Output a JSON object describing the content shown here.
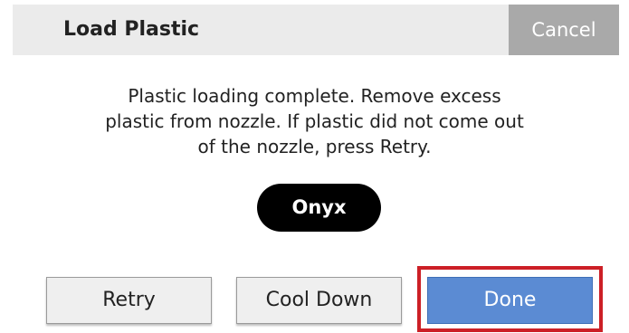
{
  "header": {
    "title": "Load Plastic",
    "cancel_label": "Cancel"
  },
  "message": {
    "lines": [
      "Plastic loading complete. Remove excess",
      "plastic from nozzle. If plastic did not come out",
      "of the nozzle, press Retry."
    ]
  },
  "material": {
    "name": "Onyx"
  },
  "buttons": {
    "retry_label": "Retry",
    "cooldown_label": "Cool Down",
    "done_label": "Done"
  },
  "colors": {
    "header_background": "#ebebeb",
    "cancel_background": "#a9a9a9",
    "badge_background": "#000000",
    "done_background": "#5b8bd3",
    "highlight_border": "#cc1f26"
  }
}
